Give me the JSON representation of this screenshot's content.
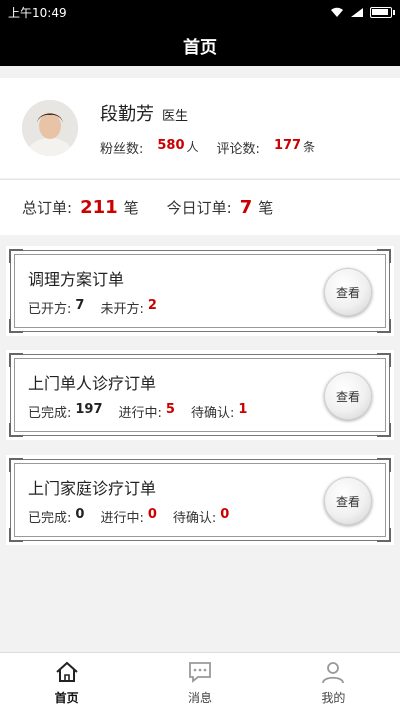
{
  "status_bar": {
    "time": "上午10:49"
  },
  "nav": {
    "title": "首页"
  },
  "profile": {
    "name": "段勤芳",
    "title": "医生",
    "fans_label": "粉丝数:",
    "fans_count": "580",
    "fans_unit": "人",
    "comments_label": "评论数:",
    "comments_count": "177",
    "comments_unit": "条"
  },
  "summary": {
    "total_label": "总订单:",
    "total_count": "211",
    "total_unit": "笔",
    "today_label": "今日订单:",
    "today_count": "7",
    "today_unit": "笔"
  },
  "cards": [
    {
      "title": "调理方案订单",
      "stats": [
        {
          "label": "已开方:",
          "value": "7"
        },
        {
          "label": "未开方:",
          "value": "2"
        }
      ],
      "button": "查看"
    },
    {
      "title": "上门单人诊疗订单",
      "stats": [
        {
          "label": "已完成:",
          "value": "197"
        },
        {
          "label": "进行中:",
          "value": "5"
        },
        {
          "label": "待确认:",
          "value": "1"
        }
      ],
      "button": "查看"
    },
    {
      "title": "上门家庭诊疗订单",
      "stats": [
        {
          "label": "已完成:",
          "value": "0"
        },
        {
          "label": "进行中:",
          "value": "0"
        },
        {
          "label": "待确认:",
          "value": "0"
        }
      ],
      "button": "查看"
    }
  ],
  "tabs": [
    {
      "label": "首页",
      "icon": "home-icon"
    },
    {
      "label": "消息",
      "icon": "message-icon"
    },
    {
      "label": "我的",
      "icon": "user-icon"
    }
  ]
}
